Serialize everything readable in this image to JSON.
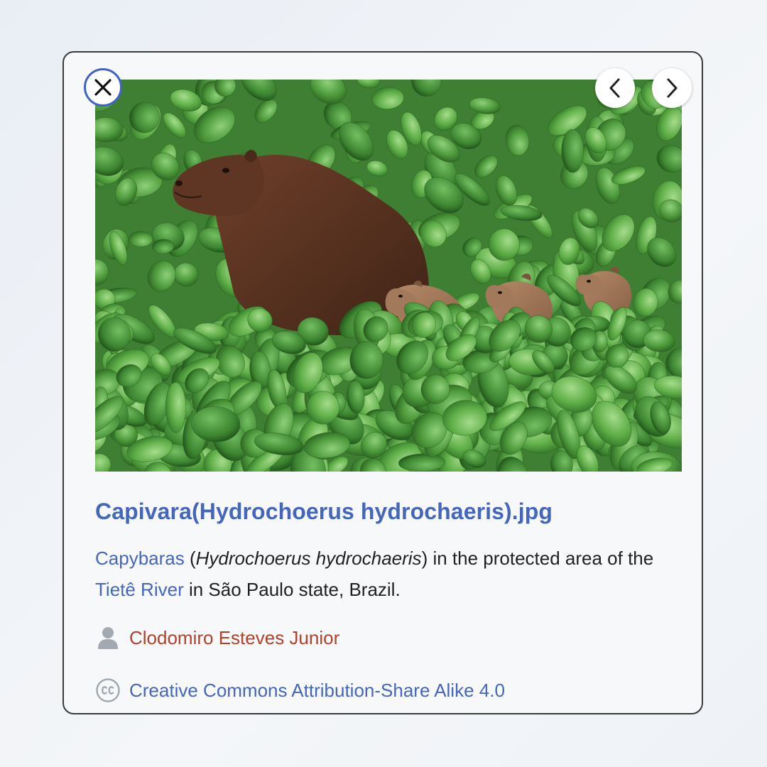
{
  "media_viewer": {
    "title": "Capivara(Hydrochoerus hydrochaeris).jpg",
    "caption": {
      "link1": "Capybaras",
      "text1": " (",
      "italic": "Hydrochoerus hydrochaeris",
      "text2": ") in the protected area of the ",
      "link2": "Tietê River",
      "text3": " in São Paulo state, Brazil."
    },
    "author": "Clodomiro Esteves Junior",
    "license": "Creative Commons Attribution-Share Alike 4.0",
    "icons": {
      "close": "close-icon",
      "prev": "chevron-left-icon",
      "next": "chevron-right-icon",
      "author": "user-icon",
      "license": "creative-commons-icon"
    },
    "colors": {
      "link": "#4466bb",
      "author": "#b0412b",
      "text": "#202122",
      "close_ring": "#3f63c5"
    }
  }
}
